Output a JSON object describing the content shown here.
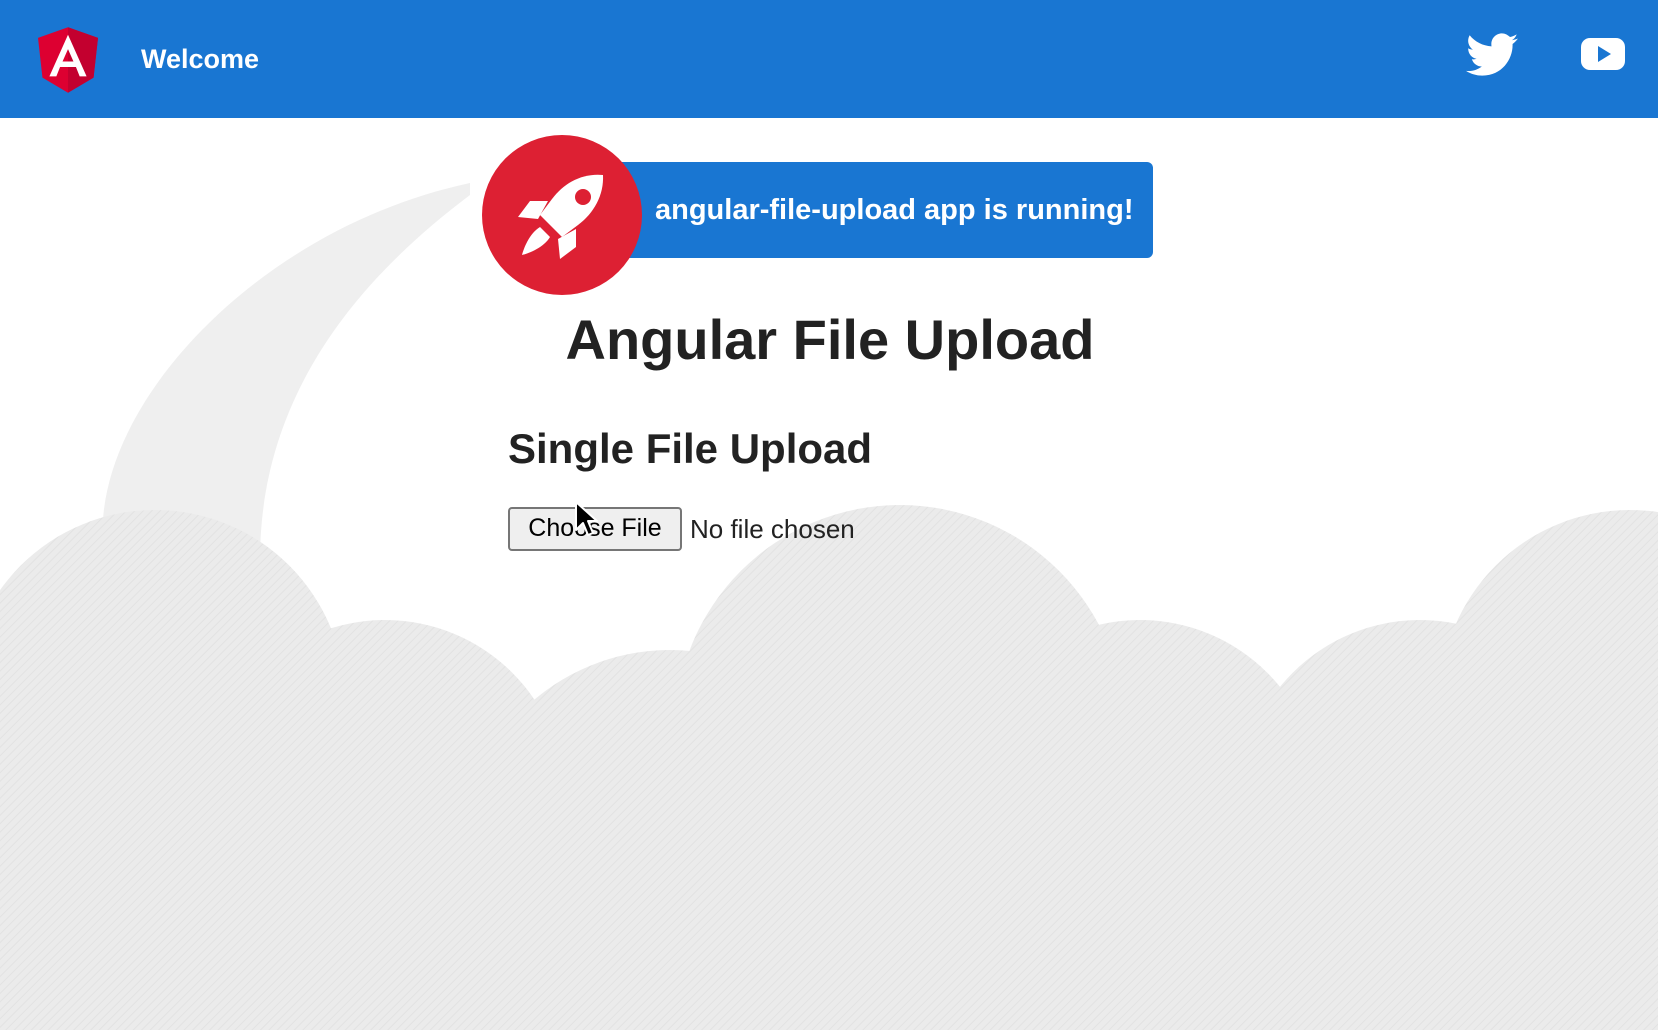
{
  "toolbar": {
    "logo_icon": "angular-logo-icon",
    "title": "Welcome",
    "links": [
      {
        "icon": "twitter-icon"
      },
      {
        "icon": "youtube-icon"
      }
    ],
    "color": "#1976d2"
  },
  "banner": {
    "icon": "rocket-icon",
    "text": "angular-file-upload app is running!",
    "color": "#1976d2",
    "icon_bg_color": "#dd2033"
  },
  "main": {
    "title": "Angular File Upload",
    "section_title": "Single File Upload",
    "file_input": {
      "button_label": "Choose File",
      "status": "No file chosen"
    }
  },
  "colors": {
    "background_decor": "#ebebeb",
    "text": "#222222"
  }
}
